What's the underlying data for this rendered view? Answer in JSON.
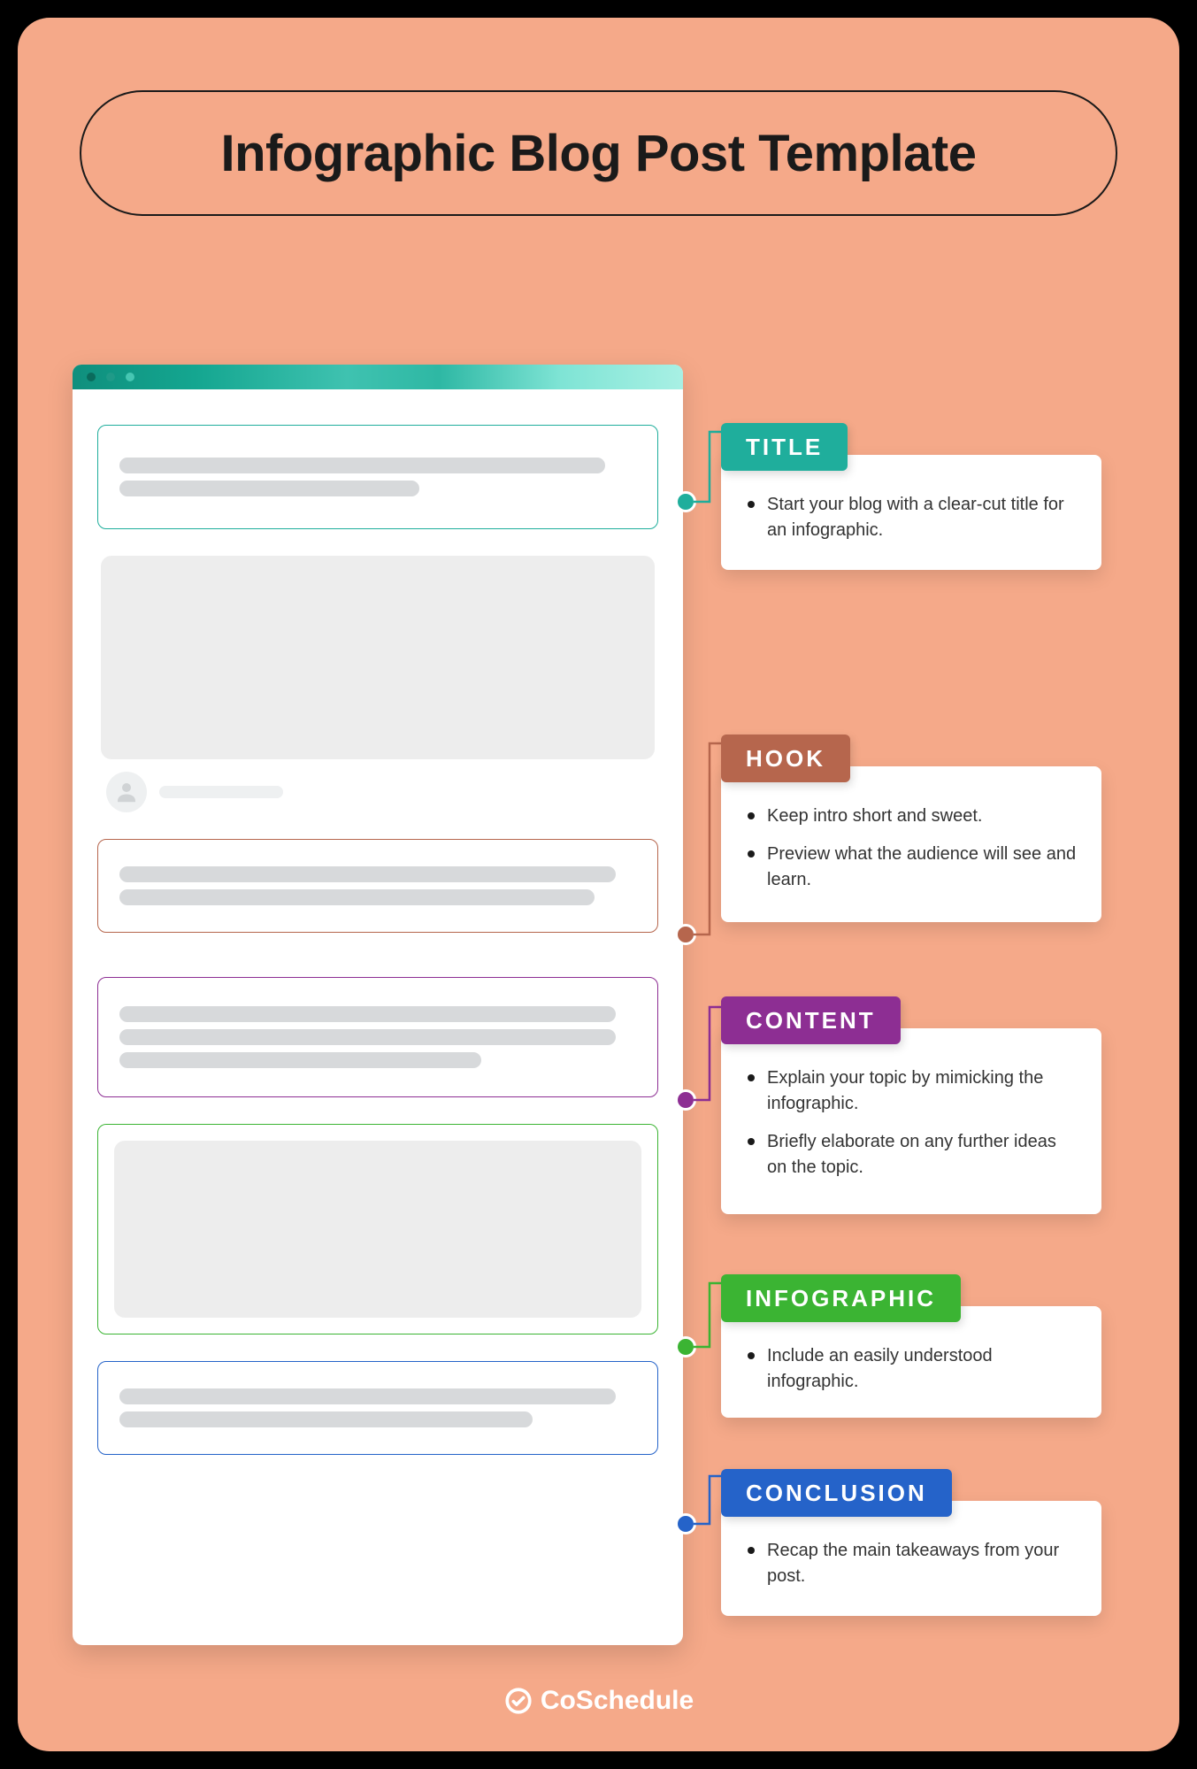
{
  "page_title": "Infographic Blog Post Template",
  "brand": "CoSchedule",
  "colors": {
    "background": "#f5a989",
    "title": "#1fae9c",
    "hook": "#b6664d",
    "content": "#8d2e93",
    "infographic": "#3bb433",
    "conclusion": "#2563c9"
  },
  "sections": [
    {
      "key": "title",
      "label": "TITLE",
      "color": "#1fae9c",
      "bullets": [
        "Start your blog with a clear-cut title for an infographic."
      ]
    },
    {
      "key": "hook",
      "label": "HOOK",
      "color": "#b6664d",
      "bullets": [
        "Keep intro short and sweet.",
        "Preview what the audience will see and learn."
      ]
    },
    {
      "key": "content",
      "label": "CONTENT",
      "color": "#8d2e93",
      "bullets": [
        "Explain your topic by mimicking the infographic.",
        "Briefly elaborate on any further ideas on the topic."
      ]
    },
    {
      "key": "infographic",
      "label": "INFOGRAPHIC",
      "color": "#3bb433",
      "bullets": [
        "Include an easily understood infographic."
      ]
    },
    {
      "key": "conclusion",
      "label": "CONCLUSION",
      "color": "#2563c9",
      "bullets": [
        "Recap the main takeaways from your post."
      ]
    }
  ]
}
